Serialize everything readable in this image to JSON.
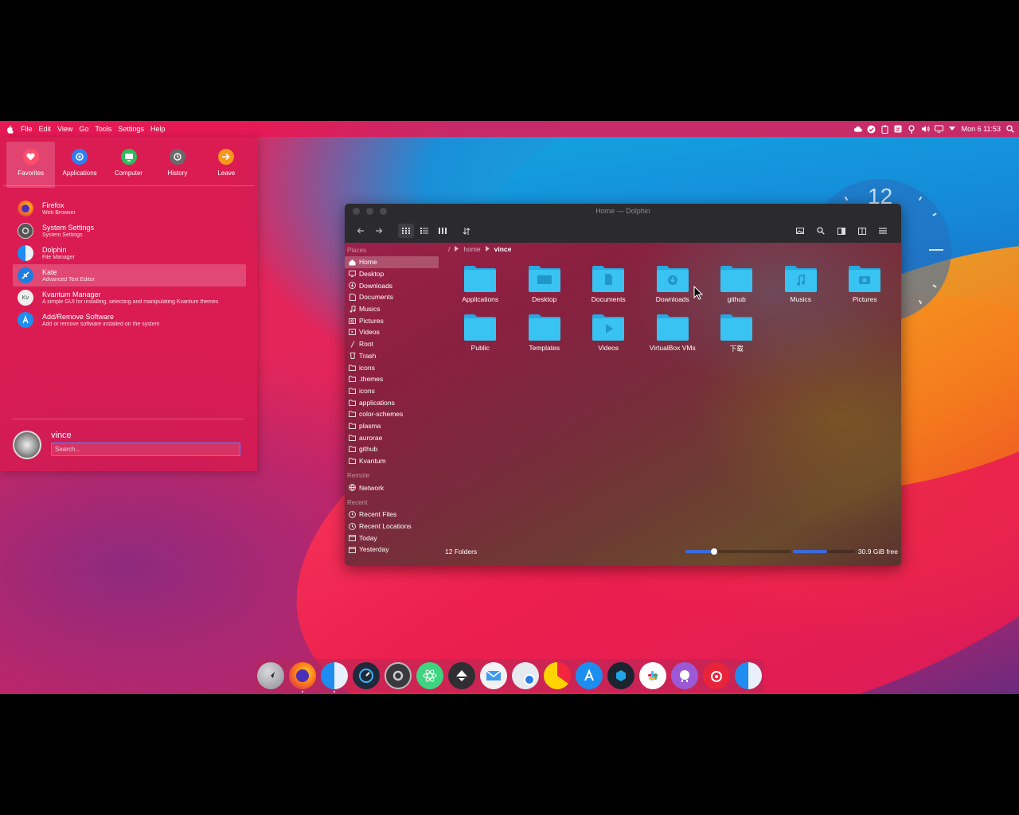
{
  "topbar": {
    "menu": [
      "File",
      "Edit",
      "View",
      "Go",
      "Tools",
      "Settings",
      "Help"
    ],
    "clock": "Mon 6 11:53"
  },
  "launcher": {
    "tabs": [
      {
        "label": "Favorites",
        "icon": "heart-icon",
        "color": "#ff4d6a"
      },
      {
        "label": "Applications",
        "icon": "apps-icon",
        "color": "#2f7ef2"
      },
      {
        "label": "Computer",
        "icon": "monitor-icon",
        "color": "#2dbd5a"
      },
      {
        "label": "History",
        "icon": "history-icon",
        "color": "#6a6a6a"
      },
      {
        "label": "Leave",
        "icon": "leave-icon",
        "color": "#f7961c"
      }
    ],
    "apps": [
      {
        "name": "Firefox",
        "desc": "Web Browser"
      },
      {
        "name": "System Settings",
        "desc": "System Settings"
      },
      {
        "name": "Dolphin",
        "desc": "File Manager"
      },
      {
        "name": "Kate",
        "desc": "Advanced Text Editor"
      },
      {
        "name": "Kvantum Manager",
        "desc": "A simple GUI for installing, selecting and manipulating Kvantum themes"
      },
      {
        "name": "Add/Remove Software",
        "desc": "Add or remove software installed on the system"
      }
    ],
    "user": "vince",
    "search_placeholder": "Search..."
  },
  "clock_widget": {
    "number": "12"
  },
  "dolphin": {
    "title": "Home — Dolphin",
    "sections": {
      "places": "Places",
      "remote": "Remote",
      "recent": "Recent"
    },
    "places": [
      "Home",
      "Desktop",
      "Downloads",
      "Documents",
      "Musics",
      "Pictures",
      "Videos",
      "Root",
      "Trash",
      "icons",
      ".themes",
      "icons",
      "applications",
      "color-schemes",
      "plasma",
      "aurorae",
      "github",
      "Kvantum"
    ],
    "remote": [
      "Network"
    ],
    "recent": [
      "Recent Files",
      "Recent Locations",
      "Today",
      "Yesterday"
    ],
    "breadcrumb": {
      "root": "/",
      "home": "home",
      "current": "vince"
    },
    "folders": [
      "Applications",
      "Desktop",
      "Documents",
      "Downloads",
      "github",
      "Musics",
      "Pictures",
      "Public",
      "Templates",
      "Videos",
      "VirtualBox VMs",
      "下载"
    ],
    "status": "12 Folders",
    "free": "30.9 GiB free",
    "zoom_level": 0.27,
    "space_used": 0.55,
    "folder_color": "#38c3f2"
  },
  "dock": {
    "apps": [
      "launchpad-icon",
      "firefox-icon",
      "finder-icon",
      "speedometer-icon",
      "settings-icon",
      "atom-icon",
      "inkscape-icon",
      "mail-icon",
      "disk-icon",
      "pie-icon",
      "appstore-icon",
      "virtualbox-icon",
      "slack-icon",
      "github-icon",
      "netease-icon",
      "finder-icon"
    ]
  }
}
